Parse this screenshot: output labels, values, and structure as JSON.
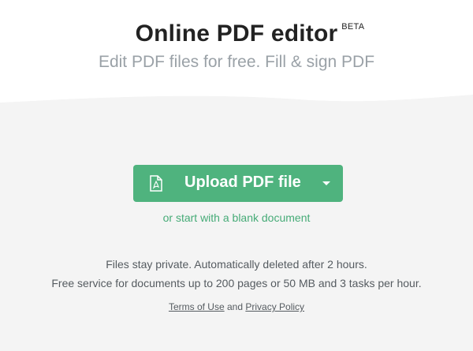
{
  "header": {
    "title": "Online PDF editor",
    "badge": "BETA",
    "subtitle": "Edit PDF files for free. Fill & sign PDF"
  },
  "upload": {
    "label": "Upload PDF file",
    "icon": "pdf-file-icon",
    "dropdown_icon": "caret-down-icon",
    "color": "#4fb37e"
  },
  "blank_link": "or start with a blank document",
  "info": {
    "line1": "Files stay private. Automatically deleted after 2 hours.",
    "line2": "Free service for documents up to 200 pages or 50 MB and 3 tasks per hour."
  },
  "legal": {
    "terms": "Terms of Use",
    "and": "and",
    "privacy": "Privacy Policy"
  }
}
